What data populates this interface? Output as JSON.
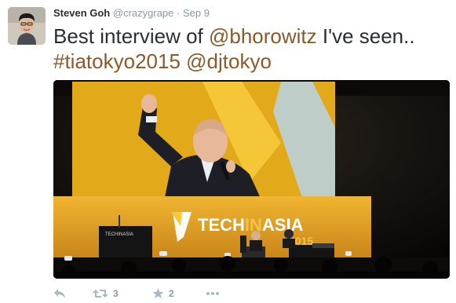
{
  "author": {
    "display_name": "Steven Goh",
    "handle": "@crazygrape",
    "separator": "·",
    "timestamp": "Sep 9"
  },
  "tweet": {
    "text_before": "Best interview of ",
    "mention_1": "@bhorowitz",
    "text_after": " I've seen..",
    "hashtag": "#tiatokyo2015",
    "mention_2": "@djtokyo"
  },
  "media": {
    "stage_banner_text": "TECHINASIA",
    "stage_banner_prefix": "TECH",
    "stage_banner_mid": "IN",
    "stage_banner_suffix": "ASIA",
    "stage_year": "2015",
    "podium_logo_text": "TECHINASIA"
  },
  "actions": {
    "reply_icon": "reply-icon",
    "retweet_icon": "retweet-icon",
    "retweet_count": "3",
    "favorite_icon": "star-icon",
    "favorite_count": "2",
    "more_icon": "more-icon"
  },
  "colors": {
    "link": "#8b5a2b",
    "name": "#292f33",
    "meta": "#8899a6",
    "action": "#aab8c2",
    "stage_yellow": "#d9a91f",
    "stage_orange": "#e39a1e"
  }
}
